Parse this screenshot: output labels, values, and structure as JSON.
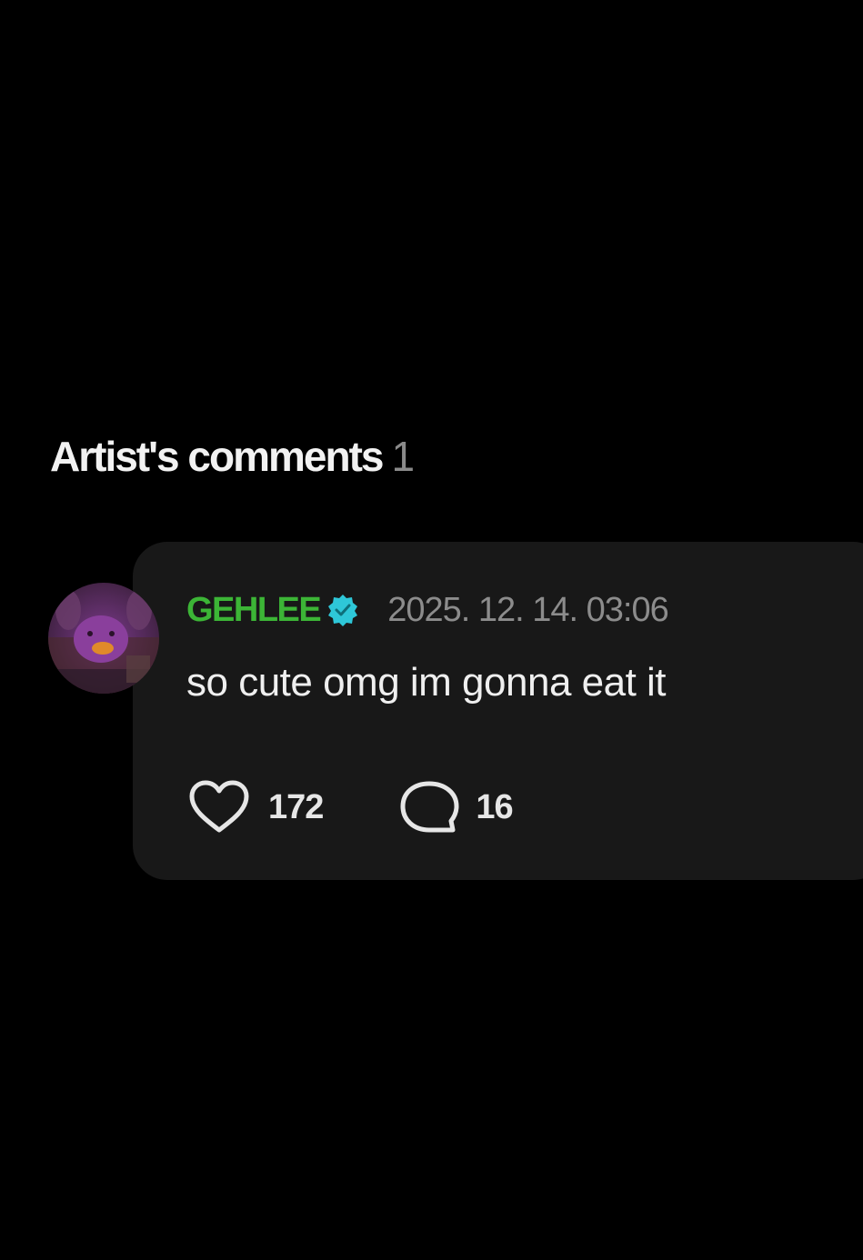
{
  "section": {
    "title": "Artist's comments",
    "count": "1"
  },
  "comment": {
    "username": "GEHLEE",
    "verified_icon": "verified-badge-icon",
    "timestamp": "2025. 12. 14. 03:06",
    "text": "so cute omg im gonna eat it",
    "likes": "172",
    "replies": "16",
    "like_icon": "heart-outline-icon",
    "reply_icon": "speech-bubble-icon"
  },
  "colors": {
    "background": "#000000",
    "card": "#181818",
    "username": "#3cb536",
    "verified": "#2ec7d8",
    "timestamp": "#8c8c8c",
    "text": "#efefef"
  }
}
